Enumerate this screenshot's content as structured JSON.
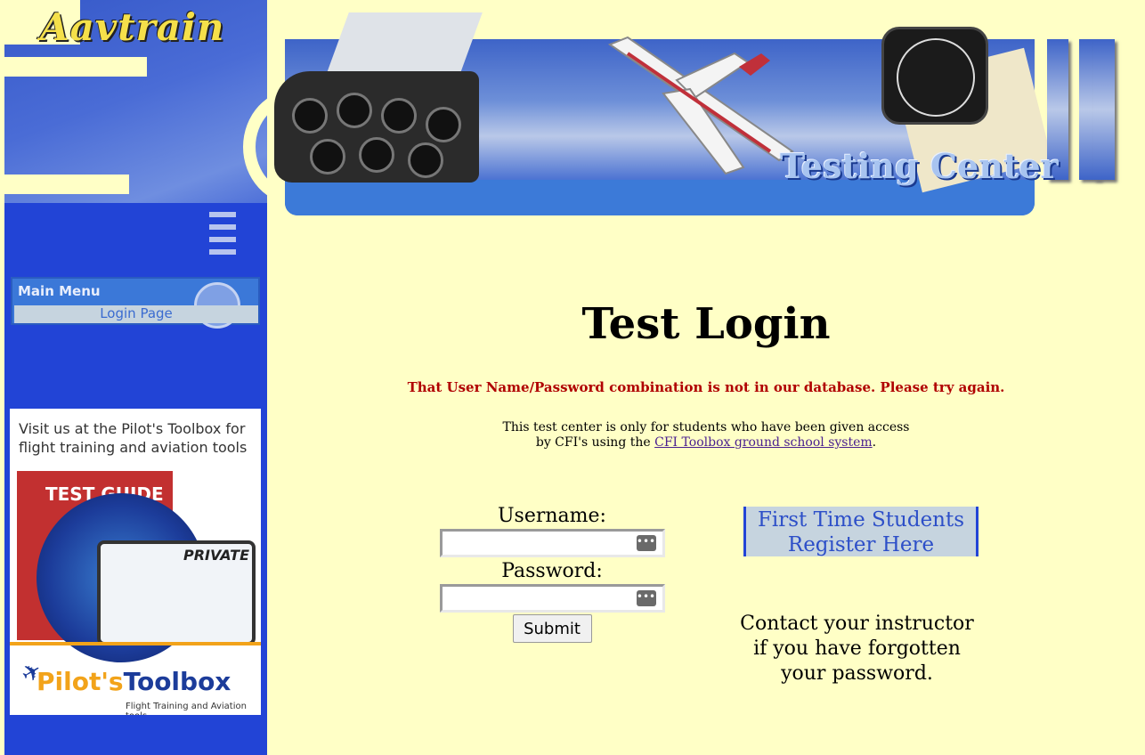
{
  "sidebar": {
    "logo_text": "Aavtrain",
    "main_menu": {
      "title": "Main Menu",
      "items": [
        {
          "label": "Login Page"
        }
      ]
    },
    "ad": {
      "text": "Visit us at the Pilot's Toolbox for flight training and aviation tools",
      "product_label": "TEST GUIDE",
      "tablet_label": "PRIVATE",
      "brand_pilots": "Pilot's",
      "brand_toolbox": "Toolbox",
      "tagline": "Flight Training and Aviation tools"
    }
  },
  "banner": {
    "title": "Testing Center"
  },
  "main": {
    "title": "Test Login",
    "error": "That User Name/Password combination is not in our database. Please try again.",
    "info_line1": "This test center is only for students who have been given access",
    "info_line2_prefix": "by CFI's using the ",
    "info_link": "CFI Toolbox ground school system",
    "info_line2_suffix": ".",
    "form": {
      "username_label": "Username:",
      "username_value": "",
      "password_label": "Password:",
      "password_value": "",
      "submit_label": "Submit"
    },
    "register": {
      "line1": "First Time Students",
      "line2": "Register Here"
    },
    "forgot": {
      "line1": "Contact your instructor",
      "line2": "if you have forgotten",
      "line3": "your password."
    }
  },
  "colors": {
    "page_bg": "#ffffc6",
    "sidebar_bg": "#2244d6",
    "error": "#b00000",
    "register_text": "#2d4fc8"
  }
}
